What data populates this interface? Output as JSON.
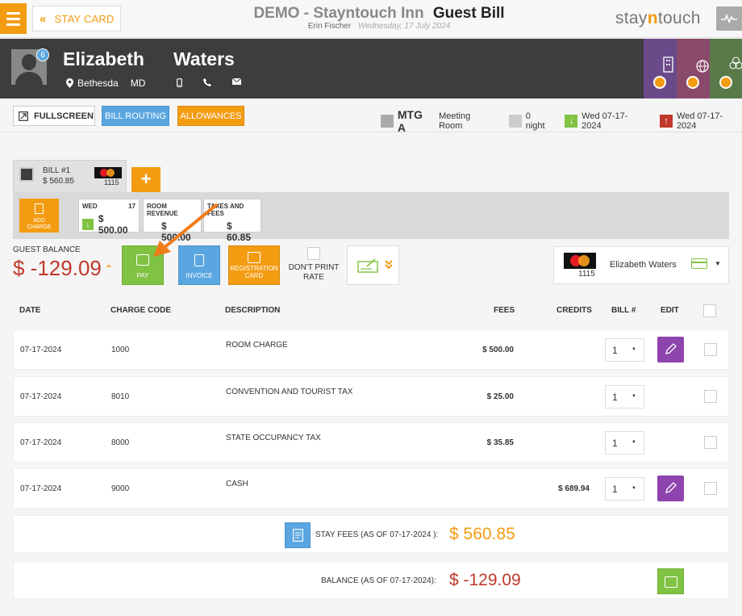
{
  "header": {
    "stay_card": "STAY CARD",
    "hotel": "DEMO - Stayntouch Inn",
    "bill_title": "Guest Bill",
    "user": "Erin Fischer",
    "date": "Wednesday, 17 July 2024",
    "logo_pre": "stay",
    "logo_n": "n",
    "logo_post": "touch"
  },
  "guest": {
    "first_name": "Elizabeth",
    "last_name": "Waters",
    "city": "Bethesda",
    "state": "MD",
    "badge_count": "6"
  },
  "actions": {
    "fullscreen": "FULLSCREEN",
    "bill_routing": "BILL ROUTING",
    "allowances": "ALLOWANCES"
  },
  "room": {
    "code": "MTG A",
    "type": "Meeting Room",
    "nights": "0 night",
    "arrival": "Wed 07-17-2024",
    "departure": "Wed 07-17-2024"
  },
  "bill_tab": {
    "name": "BILL #1",
    "amount": "$ 560.85",
    "card_last4": "1115",
    "add_label": "+"
  },
  "charge_cards": {
    "add_charge_1": "ADD",
    "add_charge_2": "CHARGE",
    "day_label": "WED",
    "day_num": "17",
    "day_amount": "$ 500.00",
    "room_rev_label": "ROOM REVENUE",
    "room_rev_amount": "$ 500.00",
    "taxes_label": "TAXES AND FEES",
    "taxes_amount": "$ 60.85"
  },
  "balance": {
    "label": "GUEST BALANCE",
    "amount": "$ -129.09",
    "pay": "PAY",
    "invoice": "INVOICE",
    "reg_card_1": "REGISTRATION",
    "reg_card_2": "CARD",
    "dont_print_1": "DON'T PRINT",
    "dont_print_2": "RATE"
  },
  "payment_card": {
    "last4": "1115",
    "holder": "Elizabeth Waters"
  },
  "table": {
    "headers": {
      "date": "DATE",
      "charge_code": "CHARGE CODE",
      "description": "DESCRIPTION",
      "fees": "FEES",
      "credits": "CREDITS",
      "bill_no": "BILL #",
      "edit": "EDIT"
    },
    "rows": [
      {
        "date": "07-17-2024",
        "code": "1000",
        "desc": "ROOM CHARGE",
        "fees": "$ 500.00",
        "credits": "",
        "bill": "1"
      },
      {
        "date": "07-17-2024",
        "code": "8010",
        "desc": "CONVENTION AND TOURIST TAX",
        "fees": "$ 25.00",
        "credits": "",
        "bill": "1"
      },
      {
        "date": "07-17-2024",
        "code": "8000",
        "desc": "STATE OCCUPANCY TAX",
        "fees": "$ 35.85",
        "credits": "",
        "bill": "1"
      },
      {
        "date": "07-17-2024",
        "code": "9000",
        "desc": "CASH",
        "fees": "",
        "credits": "$ 689.94",
        "bill": "1"
      }
    ]
  },
  "summary": {
    "stay_fees_label": "STAY FEES (AS OF  07-17-2024 ):",
    "stay_fees_amount": "$ 560.85",
    "balance_label": "BALANCE (AS OF  07-17-2024):",
    "balance_amount": "$ -129.09"
  },
  "colors": {
    "accent": "#f39c12",
    "green": "#80c242",
    "blue": "#5aa6e0",
    "purple": "#8e44ad",
    "red": "#c0392b",
    "dark": "#3d3d3d"
  }
}
